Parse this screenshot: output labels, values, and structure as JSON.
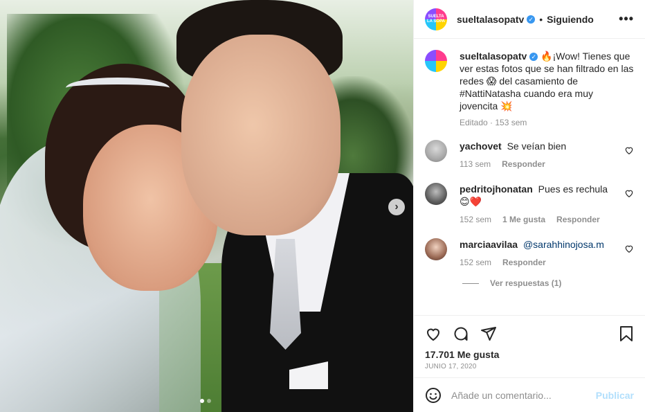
{
  "header": {
    "username": "sueltalasopatv",
    "separator": "•",
    "follow_status": "Siguiendo",
    "more": "•••",
    "logo_text": "SUELTA LA SOPA"
  },
  "caption": {
    "username": "sueltalasopatv",
    "text": "🔥¡Wow! Tienes que ver estas fotos que se han filtrado en las redes 😱 del casamiento de #NattiNatasha cuando era muy jovencita 💥",
    "meta": "Editado · 153 sem"
  },
  "comments": [
    {
      "username": "yachovet",
      "text": "Se veían bien",
      "time": "113 sem",
      "likes": "",
      "reply": "Responder"
    },
    {
      "username": "pedritojhonatan",
      "text": "Pues es rechula 😊❤️",
      "time": "152 sem",
      "likes": "1 Me gusta",
      "reply": "Responder"
    },
    {
      "username": "marciaavilaa",
      "text": "@sarahhinojosa.m",
      "time": "152 sem",
      "likes": "",
      "reply": "Responder"
    }
  ],
  "view_replies": "Ver respuestas (1)",
  "likes_text": "17.701 Me gusta",
  "date": "JUNIO 17, 2020",
  "comment_box": {
    "placeholder": "Añade un comentario...",
    "publish": "Publicar"
  },
  "media": {
    "next": "›"
  },
  "colors": {
    "accent": "#3897f0",
    "publish_disabled": "#b2dffc",
    "secondary_text": "#8e8e8e"
  }
}
